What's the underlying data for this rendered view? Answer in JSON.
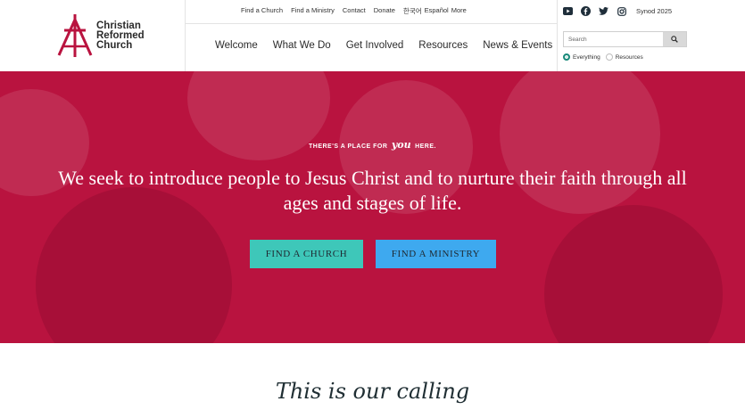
{
  "logo": {
    "line1": "Christian",
    "line2": "Reformed",
    "line3": "Church",
    "color": "#b9133f"
  },
  "utility_nav": [
    "Find a Church",
    "Find a Ministry",
    "Contact",
    "Donate",
    "한국어",
    "Español",
    "More"
  ],
  "main_nav": [
    "Welcome",
    "What We Do",
    "Get Involved",
    "Resources",
    "News & Events"
  ],
  "social": {
    "icons": [
      "youtube-icon",
      "facebook-icon",
      "twitter-icon",
      "instagram-icon"
    ],
    "synod_label": "Synod 2025"
  },
  "search": {
    "placeholder": "Search",
    "options": [
      "Everything",
      "Resources"
    ],
    "selected": "Everything"
  },
  "hero": {
    "eyebrow_pre": "THERE'S A PLACE FOR",
    "eyebrow_em": "you",
    "eyebrow_post": "HERE.",
    "headline": "We seek to introduce people to Jesus Christ and to nurture their faith through all ages and stages of life.",
    "buttons": {
      "church": "FIND A CHURCH",
      "ministry": "FIND A MINISTRY"
    },
    "bg_color": "#b9133f"
  },
  "calling": "This is our calling"
}
